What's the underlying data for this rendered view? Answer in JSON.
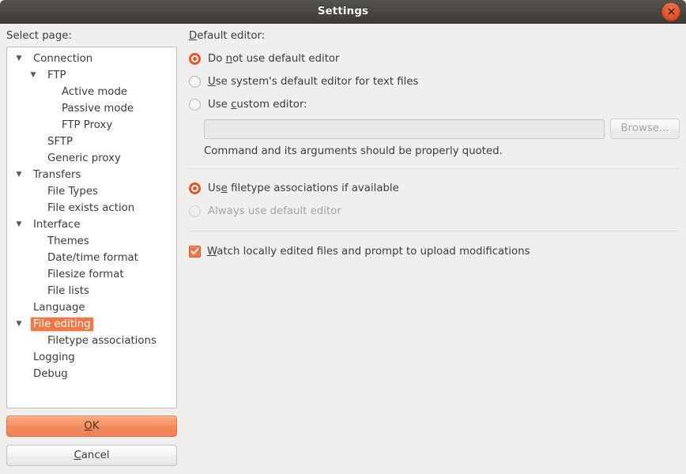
{
  "window": {
    "title": "Settings",
    "close_icon": "close-icon"
  },
  "colors": {
    "accent_orange": "#f07746",
    "radio_selected": "#e2562a",
    "checkbox_fill": "#f0764a",
    "titlebar": "#4a4741",
    "window_bg": "#f0efee",
    "selection_text": "#ffffff"
  },
  "sidebar": {
    "label": "Select page:",
    "items": [
      {
        "label": "Connection",
        "level": 0,
        "arrow": "▼",
        "selected": false
      },
      {
        "label": "FTP",
        "level": 1,
        "arrow": "▼",
        "selected": false
      },
      {
        "label": "Active mode",
        "level": 2,
        "arrow": "",
        "selected": false
      },
      {
        "label": "Passive mode",
        "level": 2,
        "arrow": "",
        "selected": false
      },
      {
        "label": "FTP Proxy",
        "level": 2,
        "arrow": "",
        "selected": false
      },
      {
        "label": "SFTP",
        "level": 1,
        "arrow": "",
        "selected": false
      },
      {
        "label": "Generic proxy",
        "level": 1,
        "arrow": "",
        "selected": false
      },
      {
        "label": "Transfers",
        "level": 0,
        "arrow": "▼",
        "selected": false
      },
      {
        "label": "File Types",
        "level": 1,
        "arrow": "",
        "selected": false
      },
      {
        "label": "File exists action",
        "level": 1,
        "arrow": "",
        "selected": false
      },
      {
        "label": "Interface",
        "level": 0,
        "arrow": "▼",
        "selected": false
      },
      {
        "label": "Themes",
        "level": 1,
        "arrow": "",
        "selected": false
      },
      {
        "label": "Date/time format",
        "level": 1,
        "arrow": "",
        "selected": false
      },
      {
        "label": "Filesize format",
        "level": 1,
        "arrow": "",
        "selected": false
      },
      {
        "label": "File lists",
        "level": 1,
        "arrow": "",
        "selected": false
      },
      {
        "label": "Language",
        "level": 0,
        "arrow": "",
        "selected": false
      },
      {
        "label": "File editing",
        "level": 0,
        "arrow": "▼",
        "selected": true
      },
      {
        "label": "Filetype associations",
        "level": 1,
        "arrow": "",
        "selected": false
      },
      {
        "label": "Logging",
        "level": 0,
        "arrow": "",
        "selected": false
      },
      {
        "label": "Debug",
        "level": 0,
        "arrow": "",
        "selected": false
      }
    ]
  },
  "buttons": {
    "ok": {
      "pre": "",
      "mnemonic": "O",
      "post": "K",
      "full": "OK"
    },
    "cancel": {
      "pre": "",
      "mnemonic": "C",
      "post": "ancel",
      "full": "Cancel"
    }
  },
  "main": {
    "default_editor_label": {
      "mnemonic": "D",
      "post": "efault editor:",
      "full": "Default editor:"
    },
    "editor_options": [
      {
        "id": "do-not-use-default-editor",
        "pre": "Do ",
        "mnemonic": "n",
        "post": "ot use default editor",
        "full": "Do not use default editor",
        "checked": true,
        "disabled": false
      },
      {
        "id": "use-system-default-editor",
        "pre": "",
        "mnemonic": "U",
        "post": "se system's default editor for text files",
        "full": "Use system's default editor for text files",
        "checked": false,
        "disabled": false
      },
      {
        "id": "use-custom-editor",
        "pre": "Use ",
        "mnemonic": "c",
        "post": "ustom editor:",
        "full": "Use custom editor:",
        "checked": false,
        "disabled": false
      }
    ],
    "custom_editor": {
      "value": "",
      "placeholder": "",
      "browse_label": "Browse...",
      "hint": "Command and its arguments should be properly quoted."
    },
    "association_options": [
      {
        "id": "use-filetype-associations",
        "pre": "Us",
        "mnemonic": "e",
        "post": " filetype associations if available",
        "full": "Use filetype associations if available",
        "checked": true,
        "disabled": false
      },
      {
        "id": "always-use-default-editor",
        "pre": "",
        "mnemonic": "",
        "post": "Always use default editor",
        "full": "Always use default editor",
        "checked": false,
        "disabled": true
      }
    ],
    "watch_checkbox": {
      "id": "watch-locally-edited-files",
      "pre": "",
      "mnemonic": "W",
      "post": "atch locally edited files and prompt to upload modifications",
      "full": "Watch locally edited files and prompt to upload modifications",
      "checked": true
    }
  }
}
